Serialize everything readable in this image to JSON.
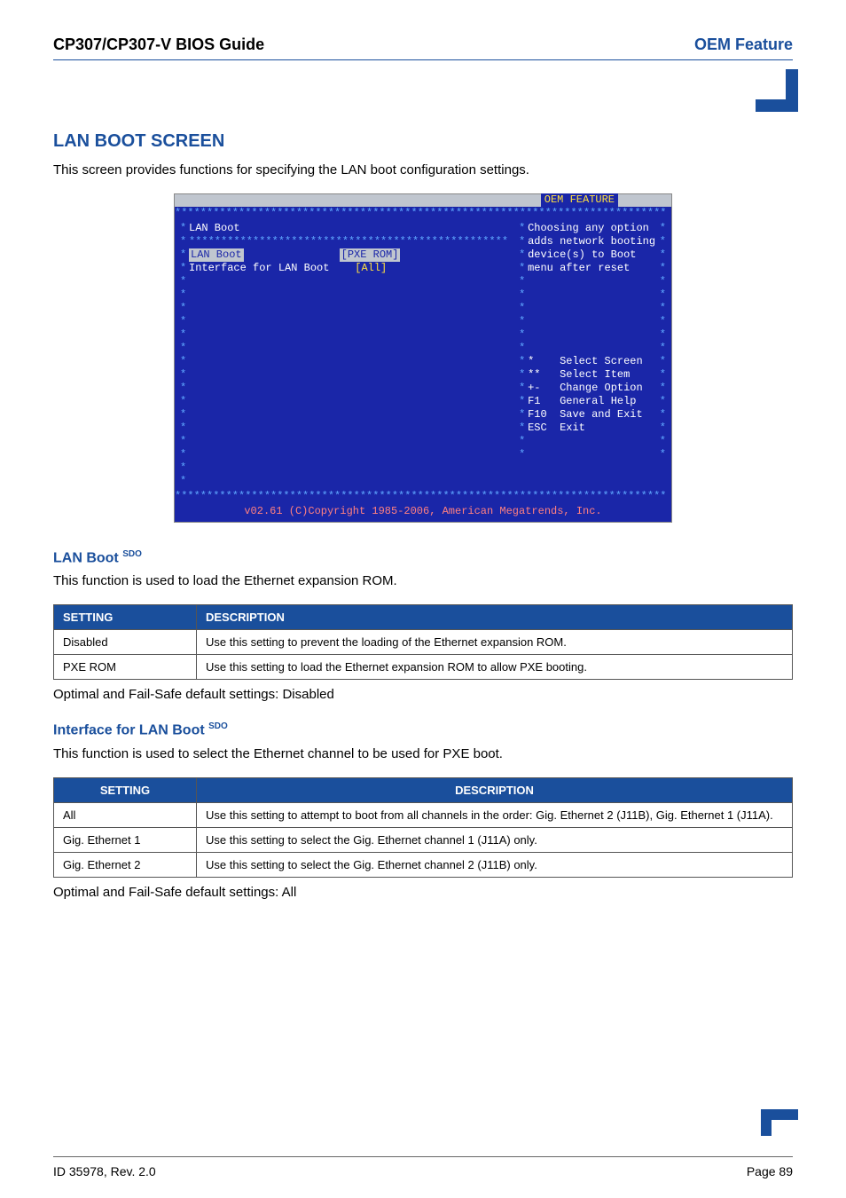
{
  "header": {
    "left": "CP307/CP307-V BIOS Guide",
    "right": "OEM Feature"
  },
  "section": {
    "title": "LAN BOOT SCREEN",
    "intro": "This screen provides functions for specifying the LAN boot configuration settings."
  },
  "bios": {
    "tab": "OEM FEATURE",
    "heading": "LAN Boot",
    "option1_label": "LAN Boot",
    "option1_value": "[PXE ROM]",
    "option2_label": "Interface for LAN Boot",
    "option2_value": "[All]",
    "help1": "Choosing any option",
    "help2": "adds network booting",
    "help3": "device(s) to Boot",
    "help4": "menu after reset",
    "nav": {
      "selectScreen_key": "*",
      "selectScreen": "Select Screen",
      "selectItem_key": "**",
      "selectItem": "Select Item",
      "changeOption_key": "+-",
      "changeOption": "Change Option",
      "help_key": "F1",
      "help": "General Help",
      "save_key": "F10",
      "save": "Save and Exit",
      "exit_key": "ESC",
      "exit": "Exit"
    },
    "footer": "v02.61 (C)Copyright 1985-2006, American Megatrends, Inc."
  },
  "lanBoot": {
    "title": "LAN Boot",
    "sup": "SDO",
    "desc": "This function is used to load the Ethernet expansion ROM.",
    "thSetting": "SETTING",
    "thDesc": "DESCRIPTION",
    "rows": [
      {
        "setting": "Disabled",
        "desc": "Use this setting to prevent the loading of the Ethernet expansion ROM."
      },
      {
        "setting": "PXE ROM",
        "desc": "Use this setting to load the Ethernet expansion ROM to allow PXE booting."
      }
    ],
    "defaultNote": "Optimal and Fail-Safe default settings: Disabled"
  },
  "iface": {
    "title": "Interface for LAN Boot",
    "sup": "SDO",
    "desc": "This function is used to select the Ethernet channel to be used for PXE boot.",
    "thSetting": "SETTING",
    "thDesc": "DESCRIPTION",
    "rows": [
      {
        "setting": "All",
        "desc": "Use this setting to attempt to boot from all channels in the order: Gig. Ethernet 2 (J11B), Gig. Ethernet 1 (J11A)."
      },
      {
        "setting": "Gig. Ethernet 1",
        "desc": "Use this setting to select the Gig. Ethernet channel 1 (J11A) only."
      },
      {
        "setting": "Gig. Ethernet 2",
        "desc": "Use this setting to select the Gig. Ethernet channel 2 (J11B) only."
      }
    ],
    "defaultNote": "Optimal and Fail-Safe default settings: All"
  },
  "footer": {
    "left": "ID 35978, Rev. 2.0",
    "right": "Page 89"
  }
}
